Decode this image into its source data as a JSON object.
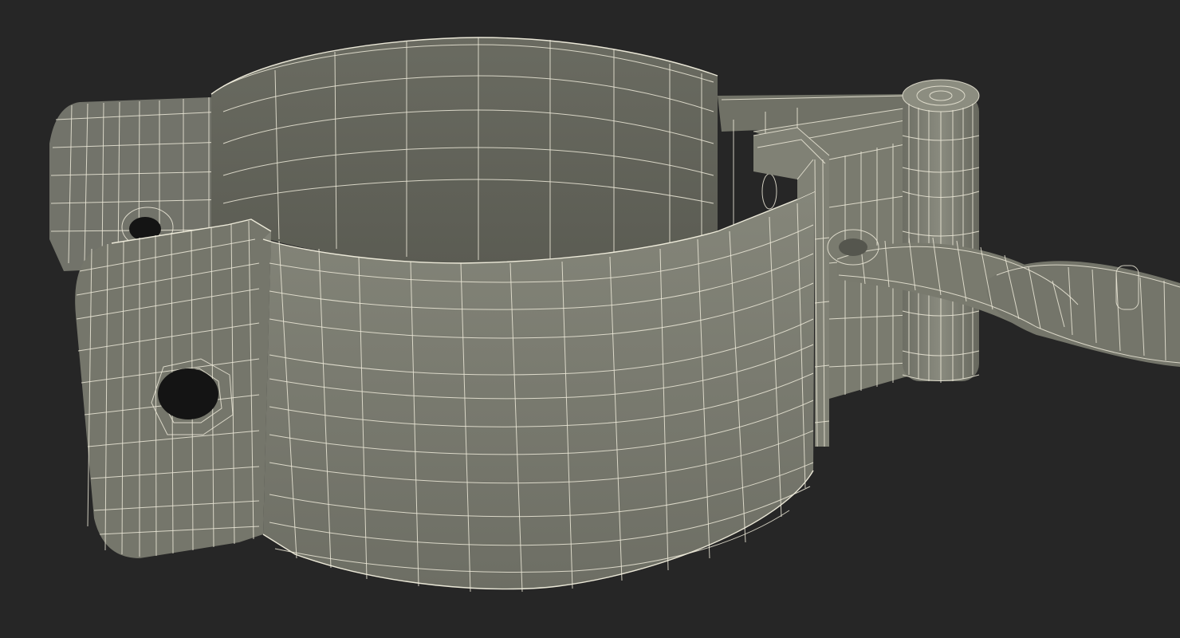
{
  "viewport": {
    "background": "#262626"
  },
  "model": {
    "subject": "wireframe-3d-render",
    "colors": {
      "surface": "#7d7e72",
      "surface_dark": "#66675d",
      "surface_inner": "#5c5d54",
      "wire": "#ece9d8",
      "hole": "#141414"
    }
  }
}
